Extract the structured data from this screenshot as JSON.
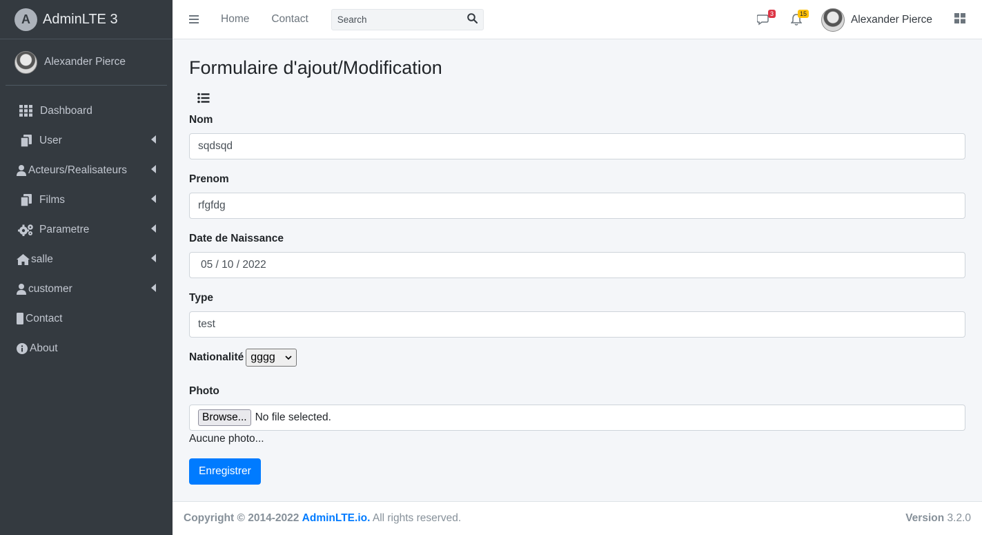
{
  "brand": {
    "name": "AdminLTE 3",
    "logo_letter": "A"
  },
  "sidebar": {
    "user_name": "Alexander Pierce",
    "items": [
      {
        "label": "Dashboard",
        "icon": "grid-icon",
        "has_children": false
      },
      {
        "label": "User",
        "icon": "copy-icon",
        "has_children": true
      },
      {
        "label": "Acteurs/Realisateurs",
        "icon": "user-icon",
        "has_children": true
      },
      {
        "label": "Films",
        "icon": "copy-icon",
        "has_children": true
      },
      {
        "label": "Parametre",
        "icon": "cogs-icon",
        "has_children": true
      },
      {
        "label": "salle",
        "icon": "home-icon",
        "has_children": true
      },
      {
        "label": "customer",
        "icon": "user-icon",
        "has_children": true
      },
      {
        "label": "Contact",
        "icon": "mobile-icon",
        "has_children": false
      },
      {
        "label": "About",
        "icon": "info-icon",
        "has_children": false
      }
    ]
  },
  "header": {
    "links": [
      "Home",
      "Contact"
    ],
    "search_placeholder": "Search",
    "messages_count": "3",
    "notifications_count": "15",
    "user_name": "Alexander Pierce"
  },
  "page": {
    "title": "Formulaire d'ajout/Modification",
    "fields": {
      "nom": {
        "label": "Nom",
        "value": "sqdsqd"
      },
      "prenom": {
        "label": "Prenom",
        "value": "rfgfdg"
      },
      "date": {
        "label": "Date de Naissance",
        "value": "05 / 10 / 2022"
      },
      "type": {
        "label": "Type",
        "value": "test"
      },
      "nationalite": {
        "label": "Nationalité",
        "selected": "gggg"
      },
      "photo": {
        "label": "Photo",
        "browse_label": "Browse...",
        "status": "No file selected.",
        "note": "Aucune photo..."
      }
    },
    "submit_label": "Enregistrer"
  },
  "footer": {
    "copyright_prefix": "Copyright © 2014-2022",
    "brand_link": "AdminLTE.io.",
    "rights": "All rights reserved.",
    "version_label": "Version",
    "version": "3.2.0"
  },
  "colors": {
    "sidebar_bg": "#343a40",
    "primary": "#007bff",
    "content_bg": "#f4f6f9"
  }
}
